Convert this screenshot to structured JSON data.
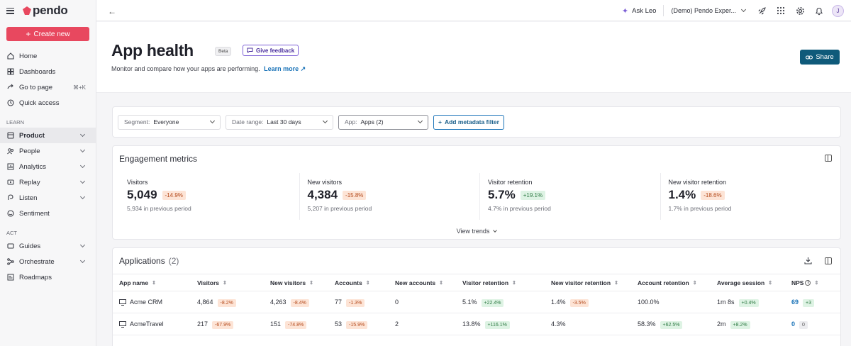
{
  "brand": {
    "name": "pendo",
    "accent": "#e8485f"
  },
  "sidebar": {
    "create_label": "Create new",
    "items_top": [
      {
        "label": "Home",
        "icon": "home-icon"
      },
      {
        "label": "Dashboards",
        "icon": "dashboard-icon"
      },
      {
        "label": "Go to page",
        "icon": "go-to-page-icon",
        "shortcut": "⌘+K"
      },
      {
        "label": "Quick access",
        "icon": "clock-icon"
      }
    ],
    "section_learn": "LEARN",
    "items_learn": [
      {
        "label": "Product",
        "icon": "product-icon"
      },
      {
        "label": "People",
        "icon": "people-icon"
      },
      {
        "label": "Analytics",
        "icon": "analytics-icon"
      },
      {
        "label": "Replay",
        "icon": "replay-icon"
      },
      {
        "label": "Listen",
        "icon": "listen-icon"
      },
      {
        "label": "Sentiment",
        "icon": "sentiment-icon"
      }
    ],
    "section_act": "ACT",
    "items_act": [
      {
        "label": "Guides",
        "icon": "guides-icon"
      },
      {
        "label": "Orchestrate",
        "icon": "orchestrate-icon"
      },
      {
        "label": "Roadmaps",
        "icon": "roadmaps-icon"
      }
    ]
  },
  "topbar": {
    "ask_leo": "Ask Leo",
    "app_selector": "(Demo) Pendo Exper...",
    "avatar_initial": "J"
  },
  "header": {
    "title": "App health",
    "beta": "Beta",
    "feedback": "Give feedback",
    "subtitle": "Monitor and compare how your apps are performing.",
    "learn_more": "Learn more",
    "share": "Share"
  },
  "filters": {
    "segment_label": "Segment:",
    "segment_value": "Everyone",
    "date_label": "Date range:",
    "date_value": "Last 30 days",
    "app_label": "App:",
    "app_value": "Apps (2)",
    "add_filter": "Add metadata filter"
  },
  "engagement": {
    "title": "Engagement metrics",
    "view_trends": "View trends",
    "metrics": [
      {
        "label": "Visitors",
        "value": "5,049",
        "change": "-14.9%",
        "previous": "5,934 in previous period"
      },
      {
        "label": "New visitors",
        "value": "4,384",
        "change": "-15.8%",
        "previous": "5,207 in previous period"
      },
      {
        "label": "Visitor retention",
        "value": "5.7%",
        "change": "+19.1%",
        "previous": "4.7% in previous period"
      },
      {
        "label": "New visitor retention",
        "value": "1.4%",
        "change": "-18.6%",
        "previous": "1.7% in previous period"
      }
    ]
  },
  "applications": {
    "title": "Applications",
    "count": "(2)",
    "columns": [
      "App name",
      "Visitors",
      "New visitors",
      "Accounts",
      "New accounts",
      "Visitor retention",
      "New visitor retention",
      "Account retention",
      "Average session",
      "NPS"
    ],
    "rows": [
      {
        "app": "Acme CRM",
        "visitors": "4,864",
        "visitors_change": "-8.2%",
        "new_visitors": "4,263",
        "new_visitors_change": "-8.4%",
        "accounts": "77",
        "accounts_change": "-1.3%",
        "new_accounts": "0",
        "visitor_retention": "5.1%",
        "visitor_retention_change": "+22.4%",
        "new_visitor_retention": "1.4%",
        "new_visitor_retention_change": "-3.5%",
        "account_retention": "100.0%",
        "avg_session": "1m 8s",
        "avg_session_change": "+0.4%",
        "nps": "69",
        "nps_change": "+3"
      },
      {
        "app": "AcmeTravel",
        "visitors": "217",
        "visitors_change": "-67.9%",
        "new_visitors": "151",
        "new_visitors_change": "-74.8%",
        "accounts": "53",
        "accounts_change": "-15.9%",
        "new_accounts": "2",
        "visitor_retention": "13.8%",
        "visitor_retention_change": "+116.1%",
        "new_visitor_retention": "4.3%",
        "account_retention": "58.3%",
        "account_retention_change": "+62.5%",
        "avg_session": "2m",
        "avg_session_change": "+8.2%",
        "nps": "0",
        "nps_change": "0"
      }
    ]
  }
}
